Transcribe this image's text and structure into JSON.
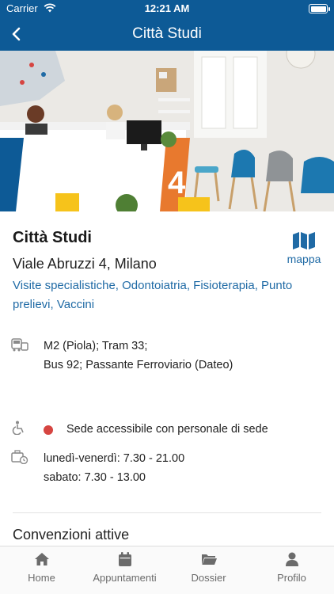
{
  "status_bar": {
    "carrier": "Carrier",
    "time": "12:21 AM"
  },
  "nav": {
    "title": "Città Studi"
  },
  "location": {
    "name": "Città Studi",
    "address": "Viale Abruzzi 4, Milano",
    "services": "Visite specialistiche, Odontoiatria, Fisioterapia, Punto prelievi, Vaccini",
    "map_label": "mappa"
  },
  "transport": {
    "line1": "M2 (Piola); Tram 33;",
    "line2": "Bus 92; Passante Ferroviario (Dateo)"
  },
  "accessibility": {
    "text": "Sede accessibile con personale di sede",
    "status_color": "#d64541"
  },
  "hours": {
    "line1": "lunedì-venerdì: 7.30 - 21.00",
    "line2": "sabato: 7.30 - 13.00"
  },
  "section": {
    "title": "Convenzioni attive"
  },
  "tabs": [
    {
      "label": "Home",
      "icon": "home-icon"
    },
    {
      "label": "Appuntamenti",
      "icon": "calendar-icon"
    },
    {
      "label": "Dossier",
      "icon": "folder-icon"
    },
    {
      "label": "Profilo",
      "icon": "user-icon"
    }
  ],
  "colors": {
    "brand": "#0d5a96",
    "link": "#1f6aa5",
    "tab_inactive": "#6b6b6b"
  }
}
